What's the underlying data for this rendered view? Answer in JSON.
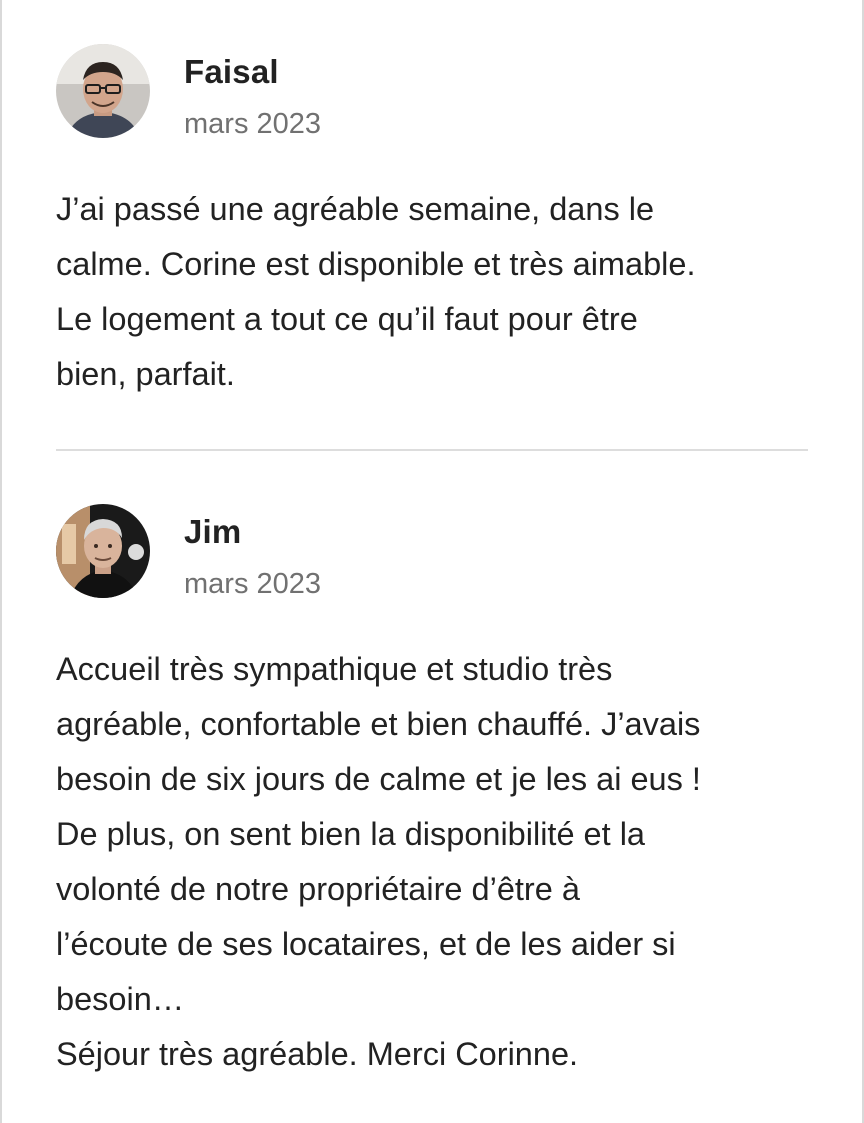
{
  "reviews": [
    {
      "name": "Faisal",
      "date": "mars 2023",
      "lines": [
        "J’ai passé une agréable semaine, dans le",
        "calme. Corine est disponible et très aimable.",
        "Le logement a tout ce qu’il faut pour être",
        "bien, parfait."
      ]
    },
    {
      "name": "Jim",
      "date": "mars 2023",
      "lines": [
        "Accueil très sympathique et studio très",
        "agréable, confortable et bien chauffé. J’avais",
        "besoin de six jours de calme et je les ai eus !",
        "De plus, on sent bien la disponibilité et la",
        "volonté de notre propriétaire d’être à",
        "l’écoute de ses locataires, et de les aider si",
        "besoin…",
        "Séjour très agréable. Merci Corinne."
      ]
    }
  ],
  "colors": {
    "text": "#222222",
    "date": "#717171",
    "divider": "#dddddd"
  }
}
